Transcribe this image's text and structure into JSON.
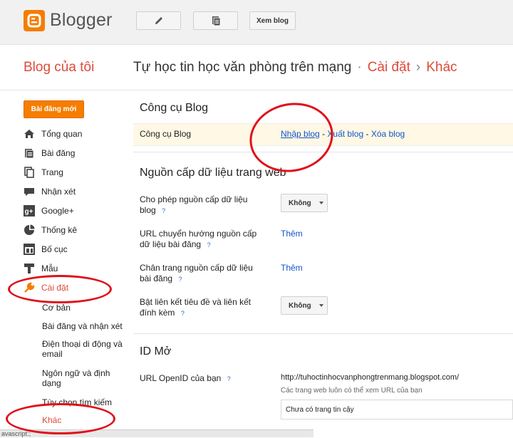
{
  "app": {
    "logo_text": "Blogger"
  },
  "toolbar": {
    "view_blog_label": "Xem blog",
    "edit_icon": "pencil-icon",
    "posts_icon": "posts-icon"
  },
  "header": {
    "my_blogs": "Blog của tôi",
    "blog_title": "Tự học tin học văn phòng trên mạng",
    "separator": "·",
    "section": "Cài đặt",
    "arrow": "›",
    "subsection": "Khác"
  },
  "sidebar": {
    "new_post": "Bài đăng mới",
    "items": [
      {
        "label": "Tổng quan",
        "icon": "home-icon"
      },
      {
        "label": "Bài đăng",
        "icon": "posts-icon"
      },
      {
        "label": "Trang",
        "icon": "page-icon"
      },
      {
        "label": "Nhận xét",
        "icon": "comment-icon"
      },
      {
        "label": "Google+",
        "icon": "google-plus-icon"
      },
      {
        "label": "Thống kê",
        "icon": "pie-chart-icon"
      },
      {
        "label": "Bố cục",
        "icon": "layout-icon"
      },
      {
        "label": "Mẫu",
        "icon": "template-icon"
      },
      {
        "label": "Cài đặt",
        "icon": "wrench-icon"
      }
    ],
    "subitems": [
      "Cơ bản",
      "Bài đăng và nhận xét",
      "Điện thoại di động và email",
      "Ngôn ngữ và định dạng",
      "Tùy chọn tìm kiếm",
      "Khác"
    ]
  },
  "main": {
    "blog_tools": {
      "heading": "Công cụ Blog",
      "label": "Công cụ Blog",
      "import": "Nhập blog",
      "export": "Xuất blog",
      "delete": "Xóa blog",
      "dash": "-"
    },
    "site_feed": {
      "heading": "Nguồn cấp dữ liệu trang web",
      "allow_feed_line1": "Cho phép nguồn cấp dữ liệu",
      "allow_feed_line2": "blog",
      "allow_feed_value": "Không",
      "redirect_line1": "URL chuyển hướng nguồn cấp",
      "redirect_line2": "dữ liệu bài đăng",
      "redirect_action": "Thêm",
      "footer_line1": "Chân trang nguồn cấp dữ liệu",
      "footer_line2": "bài đăng",
      "footer_action": "Thêm",
      "enclosure_line1": "Bật liên kết tiêu đề và liên kết",
      "enclosure_line2": "đính kèm",
      "enclosure_value": "Không",
      "help": "?"
    },
    "openid": {
      "heading": "ID Mở",
      "label": "URL OpenID của bạn",
      "url": "http://tuhoctinhocvanphongtrenmang.blogspot.com/",
      "hint": "Các trang web luôn có thể xem URL của bạn",
      "trusted": "Chưa có trang tin cậy"
    }
  },
  "status_bar": {
    "text": "avascript:;"
  },
  "colors": {
    "accent": "#f57d00",
    "link": "#1155cc",
    "annotation": "#e0101a"
  }
}
